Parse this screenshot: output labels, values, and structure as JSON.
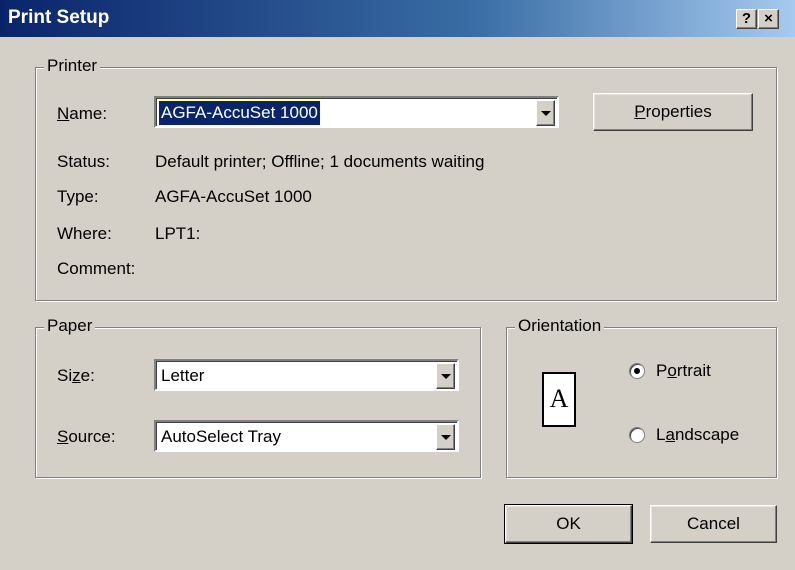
{
  "window": {
    "title": "Print Setup",
    "help_label": "?",
    "close_label": "×"
  },
  "printer": {
    "group_label": "Printer",
    "name_label_u": "N",
    "name_label_rest": "ame:",
    "name_value": "AGFA-AccuSet 1000",
    "properties_label_u": "P",
    "properties_label_rest": "roperties",
    "status_label": "Status:",
    "status_value": "Default printer; Offline; 1 documents waiting",
    "type_label": "Type:",
    "type_value": "AGFA-AccuSet 1000",
    "where_label": "Where:",
    "where_value": "LPT1:",
    "comment_label": "Comment:"
  },
  "paper": {
    "group_label": "Paper",
    "size_label_pre": "Si",
    "size_label_u": "z",
    "size_label_rest": "e:",
    "size_value": "Letter",
    "source_label_u": "S",
    "source_label_rest": "ource:",
    "source_value": "AutoSelect Tray"
  },
  "orientation": {
    "group_label": "Orientation",
    "page_icon_letter": "A",
    "portrait_pre": "P",
    "portrait_u": "o",
    "portrait_rest": "rtrait",
    "landscape_pre": "L",
    "landscape_u": "a",
    "landscape_rest": "ndscape",
    "selected": "Portrait"
  },
  "buttons": {
    "ok_label": "OK",
    "cancel_label": "Cancel"
  }
}
